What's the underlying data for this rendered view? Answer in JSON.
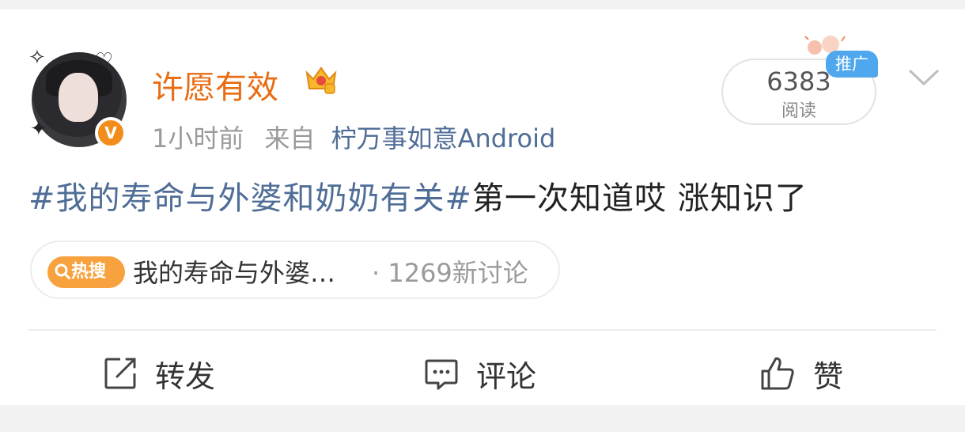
{
  "post": {
    "author": "许愿有效",
    "time": "1小时前",
    "source_prefix": "来自",
    "source_app": "柠万事如意Android",
    "read_count": "6383",
    "read_label": "阅读",
    "promo_tag": "推广",
    "topic": "#我的寿命与外婆和奶奶有关#",
    "body": "第一次知道哎 涨知识了"
  },
  "hot_search": {
    "badge": "热搜",
    "title": "我的寿命与外婆…",
    "separator": "·",
    "count": "1269新讨论"
  },
  "actions": {
    "repost": "转发",
    "comment": "评论",
    "like": "赞"
  },
  "colors": {
    "name": "#e86c13",
    "link": "#4f6d96",
    "hot_badge": "#f7a23e",
    "promo": "#4fa7ee"
  },
  "icons": [
    "verified-icon",
    "crown-icon",
    "chevron-down-icon",
    "search-icon",
    "repost-icon",
    "comment-icon",
    "thumbs-up-icon"
  ]
}
